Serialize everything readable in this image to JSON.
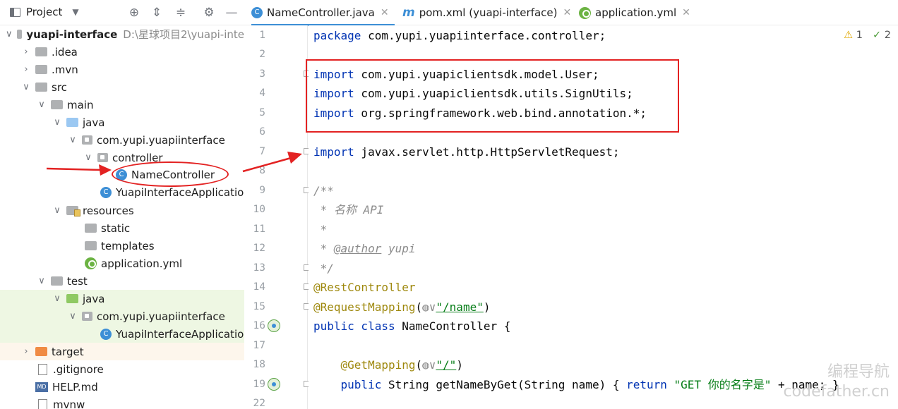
{
  "project_panel": {
    "title": "Project"
  },
  "tree": [
    {
      "label": "yuapi-interface",
      "path": "D:\\星球项目2\\yuapi-inte"
    },
    {
      "label": ".idea"
    },
    {
      "label": ".mvn"
    },
    {
      "label": "src"
    },
    {
      "label": "main"
    },
    {
      "label": "java"
    },
    {
      "label": "com.yupi.yuapiinterface"
    },
    {
      "label": "controller"
    },
    {
      "label": "NameController"
    },
    {
      "label": "YuapiInterfaceApplicatio"
    },
    {
      "label": "resources"
    },
    {
      "label": "static"
    },
    {
      "label": "templates"
    },
    {
      "label": "application.yml"
    },
    {
      "label": "test"
    },
    {
      "label": "java"
    },
    {
      "label": "com.yupi.yuapiinterface"
    },
    {
      "label": "YuapiInterfaceApplicatio"
    },
    {
      "label": "target"
    },
    {
      "label": ".gitignore"
    },
    {
      "label": "HELP.md"
    },
    {
      "label": "mvnw"
    }
  ],
  "tabs": [
    {
      "label": "NameController.java",
      "icon": "C"
    },
    {
      "label": "pom.xml (yuapi-interface)",
      "icon": "m"
    },
    {
      "label": "application.yml"
    }
  ],
  "inspection": {
    "warnings": "1",
    "checks": "2"
  },
  "line_numbers": [
    "1",
    "2",
    "3",
    "4",
    "5",
    "6",
    "7",
    "8",
    "9",
    "10",
    "11",
    "12",
    "13",
    "14",
    "15",
    "16",
    "17",
    "18",
    "19",
    "22"
  ],
  "code": {
    "l1_kw": "package",
    "l1_rest": " com.yupi.yuapiinterface.controller;",
    "l3_kw": "import",
    "l3_rest": " com.yupi.yuapiclientsdk.model.User;",
    "l4_kw": "import",
    "l4_rest": " com.yupi.yuapiclientsdk.utils.SignUtils;",
    "l5_kw": "import",
    "l5_rest": " org.springframework.web.bind.annotation.*;",
    "l7_kw": "import",
    "l7_rest": " javax.servlet.http.HttpServletRequest;",
    "l9": "/**",
    "l10": " * 名称 API",
    "l11": " *",
    "l12_a": " * ",
    "l12_tag": "@author",
    "l12_b": " yupi",
    "l13": " */",
    "l14": "@RestController",
    "l15_an": "@RequestMapping",
    "l15_p": "(",
    "l15_g": "◍∨",
    "l15_s": "\"/name\"",
    "l15_e": ")",
    "l16_kw": "public class",
    "l16_rest": " NameController {",
    "l18_an": "    @GetMapping",
    "l18_p": "(",
    "l18_g": "◍∨",
    "l18_s": "\"/\"",
    "l18_e": ")",
    "l19_kw": "    public",
    "l19_a": " String ",
    "l19_b": "getNameByGet(String name) { ",
    "l19_kw2": "return",
    "l19_s": " \"GET 你的名字是\"",
    "l19_e": " + name; }"
  },
  "watermark": {
    "line1": "编程导航",
    "line2": "codefather.cn"
  }
}
